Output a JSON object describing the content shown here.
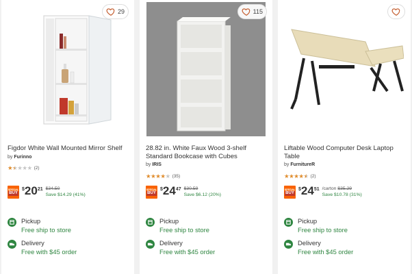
{
  "products": [
    {
      "favorite_count": "29",
      "title": "Figdor White Wall Mounted Mirror Shelf",
      "brand_prefix": "by",
      "brand": "Furinno",
      "rating": 1.5,
      "review_count": "(2)",
      "badge": {
        "line1": "SPECIAL",
        "line2": "BUY"
      },
      "currency": "$",
      "price_dollars": "20",
      "price_cents": "21",
      "unit": "",
      "was_price": "$34.50",
      "save_text": "Save $14.29 (41%)",
      "pickup_label": "Pickup",
      "pickup_detail": "Free ship to store",
      "delivery_label": "Delivery",
      "delivery_detail": "Free with $45 order"
    },
    {
      "favorite_count": "115",
      "title": "28.82 in. White Faux Wood 3-shelf Standard Bookcase with Cubes",
      "brand_prefix": "by",
      "brand": "IRIS",
      "rating": 4,
      "review_count": "(35)",
      "badge": {
        "line1": "SPECIAL",
        "line2": "BUY"
      },
      "currency": "$",
      "price_dollars": "24",
      "price_cents": "47",
      "unit": "",
      "was_price": "$30.59",
      "save_text": "Save $6.12 (20%)",
      "pickup_label": "Pickup",
      "pickup_detail": "Free ship to store",
      "delivery_label": "Delivery",
      "delivery_detail": "Free with $45 order"
    },
    {
      "favorite_count": "",
      "title": "Liftable Wood Computer Desk Laptop Table",
      "brand_prefix": "by",
      "brand": "FurnitureR",
      "rating": 4.5,
      "review_count": "(2)",
      "badge": {
        "line1": "SPECIAL",
        "line2": "BUY"
      },
      "currency": "$",
      "price_dollars": "24",
      "price_cents": "51",
      "unit": "/carton",
      "was_price": "$35.29",
      "save_text": "Save $10.78 (31%)",
      "pickup_label": "Pickup",
      "pickup_detail": "Free ship to store",
      "delivery_label": "Delivery",
      "delivery_detail": "Free with $45 order"
    }
  ],
  "colors": {
    "accent": "#f96302",
    "star": "#e08c2c",
    "success": "#2e8540"
  },
  "icons": {
    "favorite": "heart-icon",
    "pickup": "pickup-icon",
    "delivery": "delivery-truck-icon"
  }
}
